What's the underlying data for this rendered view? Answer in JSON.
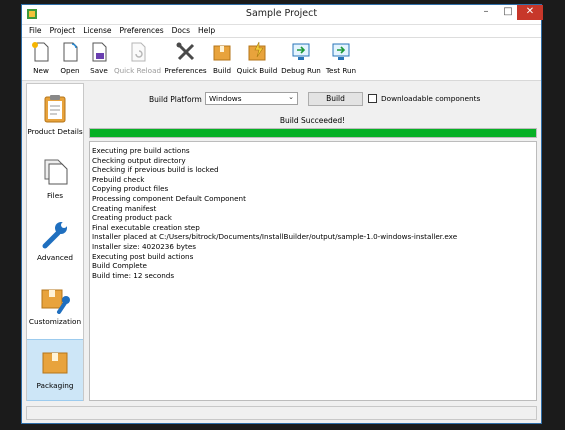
{
  "window": {
    "title": "Sample Project",
    "minimize": "–",
    "maximize": "□",
    "close": "✕"
  },
  "menu": [
    "File",
    "Project",
    "License",
    "Preferences",
    "Docs",
    "Help"
  ],
  "toolbar": [
    {
      "label": "New",
      "icon": "new-file-icon",
      "enabled": true
    },
    {
      "label": "Open",
      "icon": "open-file-icon",
      "enabled": true
    },
    {
      "label": "Save",
      "icon": "save-icon",
      "enabled": true
    },
    {
      "label": "Quick Reload",
      "icon": "reload-icon",
      "enabled": false
    },
    {
      "label": "Preferences",
      "icon": "tools-icon",
      "enabled": true
    },
    {
      "label": "Build",
      "icon": "package-icon",
      "enabled": true
    },
    {
      "label": "Quick Build",
      "icon": "quick-package-icon",
      "enabled": true
    },
    {
      "label": "Debug Run",
      "icon": "debug-run-icon",
      "enabled": true
    },
    {
      "label": "Test Run",
      "icon": "test-run-icon",
      "enabled": true
    }
  ],
  "sidebar": [
    {
      "label": "Product Details",
      "icon": "clipboard-icon",
      "selected": false
    },
    {
      "label": "Files",
      "icon": "files-icon",
      "selected": false
    },
    {
      "label": "Advanced",
      "icon": "wrench-icon",
      "selected": false
    },
    {
      "label": "Customization",
      "icon": "box-wrench-icon",
      "selected": false
    },
    {
      "label": "Packaging",
      "icon": "box-icon",
      "selected": true
    }
  ],
  "build": {
    "platform_label": "Build Platform",
    "platform_value": "Windows",
    "build_button": "Build",
    "downloadable_label": "Downloadable components",
    "downloadable_checked": false,
    "status": "Build Succeeded!",
    "progress": 1.0
  },
  "log": [
    "Executing pre build actions",
    "Checking output directory",
    "Checking if previous build is locked",
    "Prebuild check",
    "Copying product files",
    "Processing component Default Component",
    "Creating manifest",
    "Creating product pack",
    "Final executable creation step",
    "Installer placed at C:/Users/bitrock/Documents/InstallBuilder/output/sample-1.0-windows-installer.exe",
    "Installer size: 4020236 bytes",
    "Executing post build actions",
    "Build Complete",
    "Build time: 12 seconds"
  ],
  "colors": {
    "progress": "#06b025",
    "selected": "#cde6f7",
    "close": "#c7372a",
    "folder": "#e8a33c"
  }
}
